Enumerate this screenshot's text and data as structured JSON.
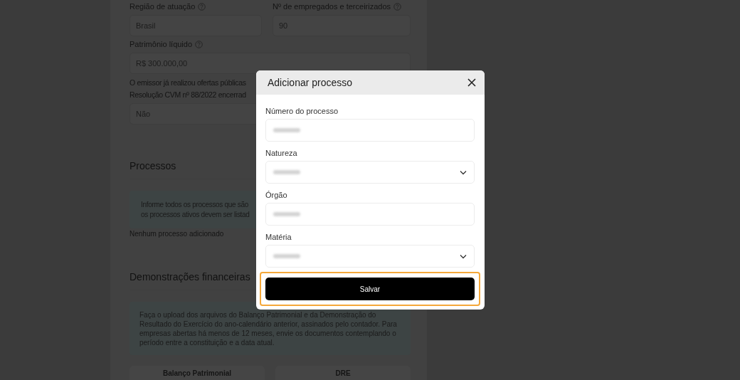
{
  "background_form": {
    "top_fields": [
      {
        "label": "Região de atuação",
        "value": "Brasil"
      },
      {
        "label": "Nº de empregados e terceirizados",
        "value": "90"
      }
    ],
    "equity": {
      "label": "Patrimônio líquido",
      "value": "R$ 300.000,00"
    },
    "offers": {
      "question_lines": [
        "O emissor já realizou ofertas públicas",
        "Resolução CVM nº 88/2022 encerrad"
      ],
      "value": "Não"
    },
    "processes": {
      "heading": "Processos",
      "info_lines": [
        "Informe todos os processos que são",
        "os processos ativos devem ser listad"
      ],
      "empty_text": "Nenhum processo adicionado"
    },
    "financials": {
      "heading": "Demonstrações financeiras",
      "info": "Faça o upload dos arquivos do Balanço Patrimonial e da Demonstração do Resultado do Exercício do ano-calendário anterior, assinados pelo contador. Para empresas abertas há menos de 12 meses, envie os documentos contemplando o período entre a constituição e a data atual.",
      "cards": [
        "Balanço Patrimonial",
        "DRE"
      ]
    }
  },
  "dialog": {
    "title": "Adicionar processo",
    "fields": [
      {
        "label": "Número do processo",
        "kind": "text"
      },
      {
        "label": "Natureza",
        "kind": "select"
      },
      {
        "label": "Órgão",
        "kind": "text"
      },
      {
        "label": "Matéria",
        "kind": "select"
      }
    ],
    "save_button": {
      "label": "Salvar",
      "focused": true
    }
  }
}
